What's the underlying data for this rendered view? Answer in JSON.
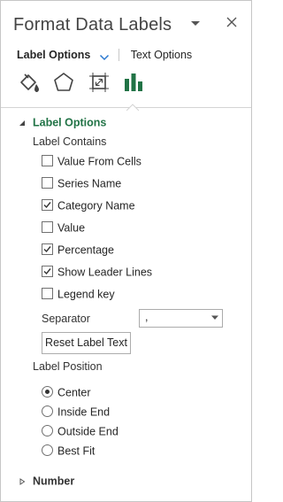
{
  "pane": {
    "title": "Format Data Labels"
  },
  "tabs": {
    "label_options": "Label Options",
    "text_options": "Text Options"
  },
  "icon_tabs": [
    "paint-bucket-icon",
    "pentagon-icon",
    "size-properties-icon",
    "bar-chart-icon"
  ],
  "colors": {
    "accent_green": "#217346",
    "chevron_blue": "#2b79d0"
  },
  "label_options_section": {
    "header": "Label Options",
    "contains_heading": "Label Contains",
    "checkboxes": [
      {
        "label": "Value From Cells",
        "checked": false
      },
      {
        "label": "Series Name",
        "checked": false
      },
      {
        "label": "Category Name",
        "checked": true
      },
      {
        "label": "Value",
        "checked": false
      },
      {
        "label": "Percentage",
        "checked": true
      },
      {
        "label": "Show Leader Lines",
        "checked": true
      },
      {
        "label": "Legend key",
        "checked": false
      }
    ],
    "separator_label": "Separator",
    "separator_value": ",",
    "reset_button": "Reset Label Text",
    "position_heading": "Label Position",
    "positions": [
      {
        "label": "Center",
        "selected": true
      },
      {
        "label": "Inside End",
        "selected": false
      },
      {
        "label": "Outside End",
        "selected": false
      },
      {
        "label": "Best Fit",
        "selected": false
      }
    ]
  },
  "number_section": {
    "header": "Number"
  }
}
